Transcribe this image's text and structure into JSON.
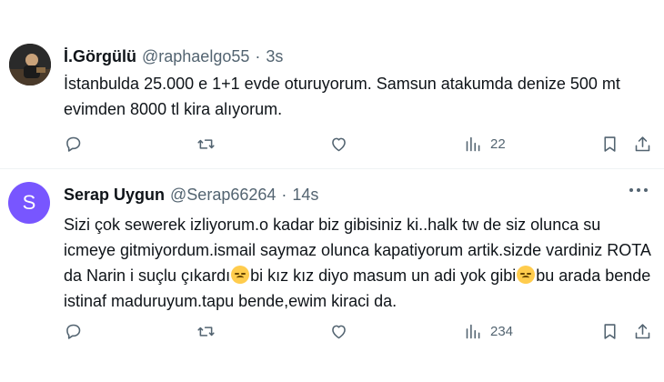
{
  "tweets": [
    {
      "name": "İ.Görgülü",
      "handle": "@raphaelgo55",
      "separator": "·",
      "time": "3s",
      "text": "İstanbulda 25.000 e 1+1 evde oturuyorum. Samsun atakumda denize 500 mt evimden 8000 tl kira alıyorum.",
      "views": "22",
      "avatar_icon": "profile-photo"
    },
    {
      "name": "Serap Uygun",
      "handle": "@Serap66264",
      "separator": "·",
      "time": "14s",
      "avatar_letter": "S",
      "avatar_color": "#7856ff",
      "text_parts": [
        "Sizi çok sewerek izliyorum.o kadar biz gibisiniz ki..halk tw de siz olunca su icmeye gitmiyordum.ismail saymaz olunca kapatiyorum artik.sizde vardiniz ROTA da Narin i suçlu çıkardı",
        "bi kız kız diyo masum un adi yok gibi",
        "bu arada bende istinaf maduruyum.tapu bende,ewim kiraci da."
      ],
      "emoji": "sad-relieved-face",
      "views": "234"
    }
  ],
  "icons": {
    "reply": "speech-bubble-icon",
    "retweet": "retweet-arrows-icon",
    "like": "heart-icon",
    "views": "bar-chart-icon",
    "bookmark": "bookmark-icon",
    "share": "share-upload-icon",
    "more": "more-dots-icon"
  },
  "colors": {
    "text": "#0f1419",
    "secondary": "#536471",
    "divider": "#eff3f4"
  }
}
